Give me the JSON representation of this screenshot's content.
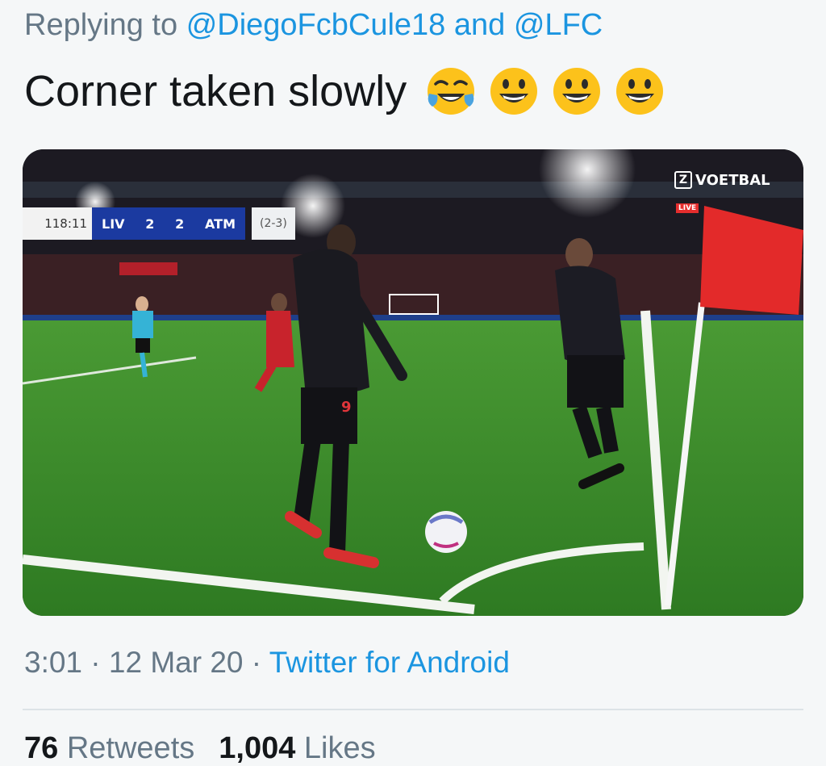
{
  "reply": {
    "prefix": "Replying to",
    "mention1": "@DiegoFcbCule18",
    "joiner": "and",
    "mention2": "@LFC"
  },
  "tweet": {
    "text": "Corner taken slowly",
    "emojis": [
      "face-with-tears-of-joy",
      "grinning-face",
      "grinning-face",
      "grinning-face"
    ]
  },
  "media": {
    "scorebug": {
      "clock": "118:11",
      "home": "LIV",
      "home_score": "2",
      "away_score": "2",
      "away": "ATM",
      "aggregate": "(2-3)"
    },
    "broadcaster": {
      "logo_letter": "Z",
      "name": "VOETBAL",
      "live": "LIVE"
    },
    "player_number": "9"
  },
  "meta": {
    "time": "3:01",
    "separator": "·",
    "date": "12 Mar 20",
    "source": "Twitter for Android"
  },
  "stats": {
    "retweets_count": "76",
    "retweets_label": "Retweets",
    "likes_count": "1,004",
    "likes_label": "Likes"
  },
  "colors": {
    "link": "#1b95e0",
    "muted": "#657786",
    "text": "#14171a",
    "pitch": "#3f8a2b",
    "scorebug": "#1b3aa0"
  }
}
